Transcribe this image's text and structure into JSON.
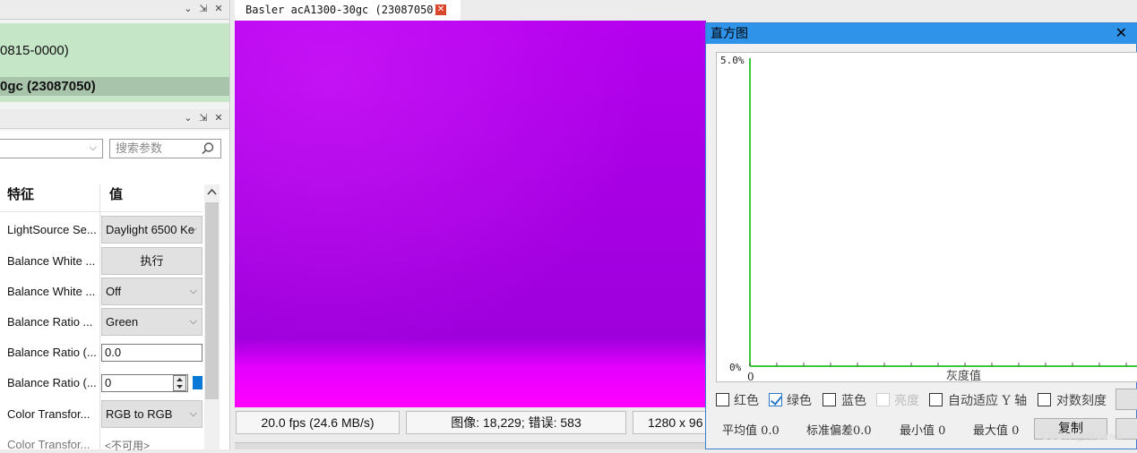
{
  "devices_panel": {
    "controls": [
      "⌄",
      "⇲",
      "✕"
    ],
    "device_id_fragment": "0815-0000)",
    "selected_device": "0gc (23087050)"
  },
  "params_panel": {
    "controls": [
      "⌄",
      "⇲",
      "✕"
    ],
    "search_placeholder": "搜索参数",
    "col_feature": "特征",
    "col_value": "值",
    "rows": [
      {
        "label": "LightSource Se...",
        "value": "Daylight 6500 Ke"
      },
      {
        "label": "Balance White ...",
        "value": "执行"
      },
      {
        "label": "Balance White ...",
        "value": "Off"
      },
      {
        "label": "Balance Ratio ...",
        "value": "Green"
      },
      {
        "label": "Balance Ratio (...",
        "value": "0.0"
      },
      {
        "label": "Balance Ratio (...",
        "value": "0"
      },
      {
        "label": "Color Transfor...",
        "value": "RGB to RGB"
      },
      {
        "label": "Color Transfor...",
        "value": "<不可用>"
      }
    ]
  },
  "tab": {
    "title": "Basler acA1300-30gc (23087050)"
  },
  "image_colors": {
    "top": "#b400ee",
    "bottom": "#ff00ff"
  },
  "status": {
    "fps": "20.0 fps (24.6 MB/s)",
    "frames": "图像: 18,229; 错误: 583",
    "resolution": "1280 x 96"
  },
  "histogram": {
    "title": "直方图",
    "close": "✕",
    "y_max_label": "5.0%",
    "y_min_label": "0%",
    "x_origin_label": "0",
    "x_label": "灰度值",
    "options": {
      "red": "红色",
      "green": "绿色",
      "blue": "蓝色",
      "brightness": "亮度",
      "auto_y": "自动适应 Y 轴",
      "log": "对数刻度"
    },
    "stats": {
      "mean": "平均值 0.0",
      "stddev": "标准偏差0.0",
      "min": "最小值 0",
      "max": "最大值 0"
    },
    "copy_button": "复制"
  },
  "watermark": "CSDN @晓dawn"
}
